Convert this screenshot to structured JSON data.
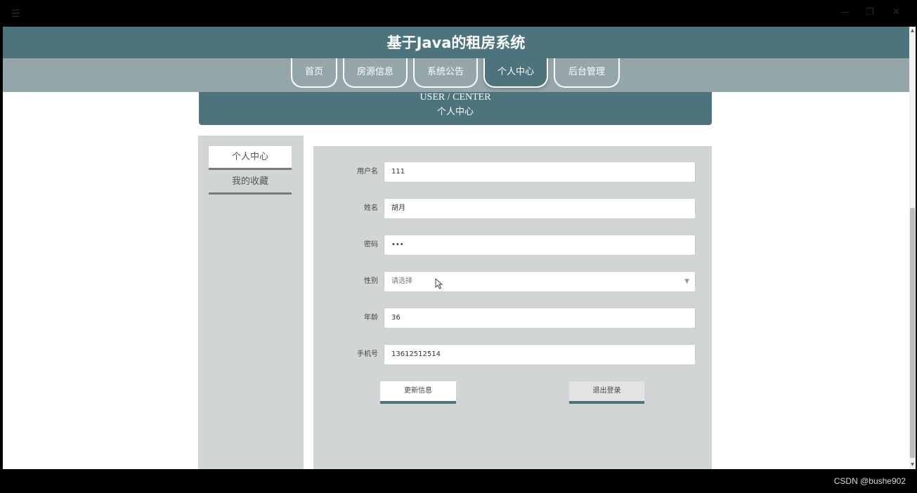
{
  "window": {
    "menu_icon": "☰",
    "minimize_icon": "—",
    "maximize_icon": "❐",
    "close_icon": "✕"
  },
  "header": {
    "title": "基于Java的租房系统"
  },
  "nav": {
    "items": [
      {
        "label": "首页"
      },
      {
        "label": "房源信息"
      },
      {
        "label": "系统公告"
      },
      {
        "label": "个人中心",
        "active": true
      },
      {
        "label": "后台管理"
      }
    ]
  },
  "banner": {
    "title_en": "USER / CENTER",
    "title_zh": "个人中心"
  },
  "sidebar": {
    "items": [
      {
        "label": "个人中心",
        "active": true
      },
      {
        "label": "我的收藏"
      }
    ]
  },
  "form": {
    "username": {
      "label": "用户名",
      "value": "111"
    },
    "name": {
      "label": "姓名",
      "value": "胡月"
    },
    "password": {
      "label": "密码",
      "value": "•••"
    },
    "gender": {
      "label": "性别",
      "placeholder": "请选择"
    },
    "age": {
      "label": "年龄",
      "value": "36"
    },
    "phone": {
      "label": "手机号",
      "value": "13612512514"
    },
    "update_button": "更新信息",
    "logout_button": "退出登录"
  },
  "watermark": "CSDN @bushe902",
  "colors": {
    "primary": "#4d737c",
    "nav_bg": "#95a6ab",
    "panel_bg": "#d1d5d6"
  }
}
